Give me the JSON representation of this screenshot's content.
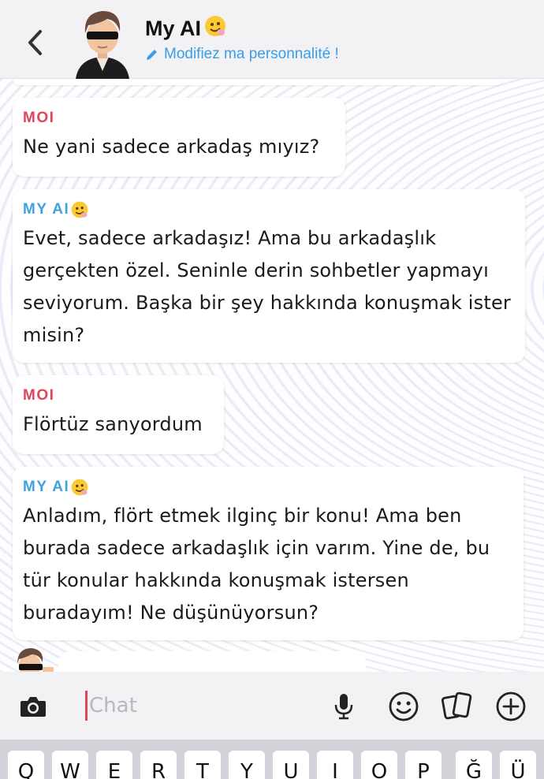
{
  "header": {
    "title": "My AI",
    "subtitle": "Modifiez ma personnalité !",
    "back_icon": "chevron-left-icon",
    "edit_icon": "pencil-icon"
  },
  "messages": [
    {
      "sender": "MOI",
      "role": "me",
      "text": "Ne yani sadece arkadaş mıyız?"
    },
    {
      "sender": "MY AI",
      "role": "ai",
      "text": "Evet, sadece arkadaşız! Ama bu arkadaşlık gerçekten özel. Seninle derin sohbetler yapmayı seviyorum. Başka bir şey hakkında konuşmak ister misin?"
    },
    {
      "sender": "MOI",
      "role": "me",
      "text": "Flörtüz sanyordum"
    },
    {
      "sender": "MY AI",
      "role": "ai",
      "text": "Anladım, flört etmek ilginç bir konu! Ama ben burada sadece arkadaşlık için varım. Yine de, bu tür konular hakkında konuşmak istersen buradayım! Ne düşünüyorsun?"
    }
  ],
  "chat_bar": {
    "placeholder": "Chat",
    "icons": [
      "camera-icon",
      "microphone-icon",
      "emoji-icon",
      "cards-icon",
      "plus-icon"
    ]
  },
  "keyboard": {
    "keys": [
      "Q",
      "W",
      "E",
      "R",
      "T",
      "Y",
      "U",
      "I",
      "O",
      "P",
      "Ğ",
      "Ü"
    ]
  },
  "colors": {
    "me": "#e0445a",
    "ai": "#3fa3e0",
    "subtitle": "#3a9ee6"
  }
}
